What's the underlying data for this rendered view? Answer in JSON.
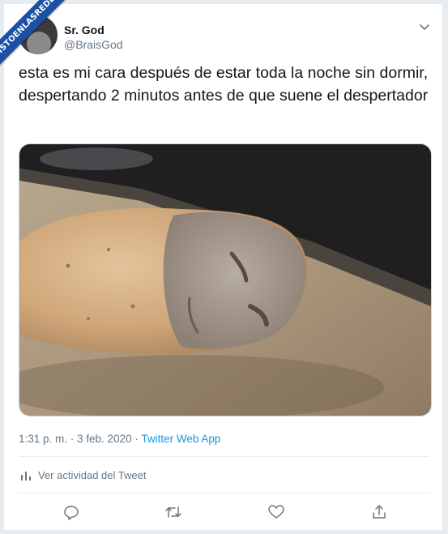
{
  "watermark": {
    "text": "VISTOENLASREDES"
  },
  "user": {
    "display_name": "Sr. God",
    "handle": "@BraisGod"
  },
  "tweet": {
    "text": "esta es mi cara después de estar toda la noche sin dormir, despertando 2 minutos antes de que suene el despertador",
    "image_subject": "potato-with-face",
    "timestamp": "1:31 p. m. · 3 feb. 2020",
    "separator": " · ",
    "source": "Twitter Web App"
  },
  "activity": {
    "label": "Ver actividad del Tweet"
  },
  "actions": {
    "icons": [
      "reply-icon",
      "retweet-icon",
      "like-icon",
      "share-icon"
    ]
  },
  "colors": {
    "link": "#1b95e0",
    "secondary_text": "#657786",
    "background": "#e6ecf0",
    "watermark_bg": "#1c4fa6"
  }
}
